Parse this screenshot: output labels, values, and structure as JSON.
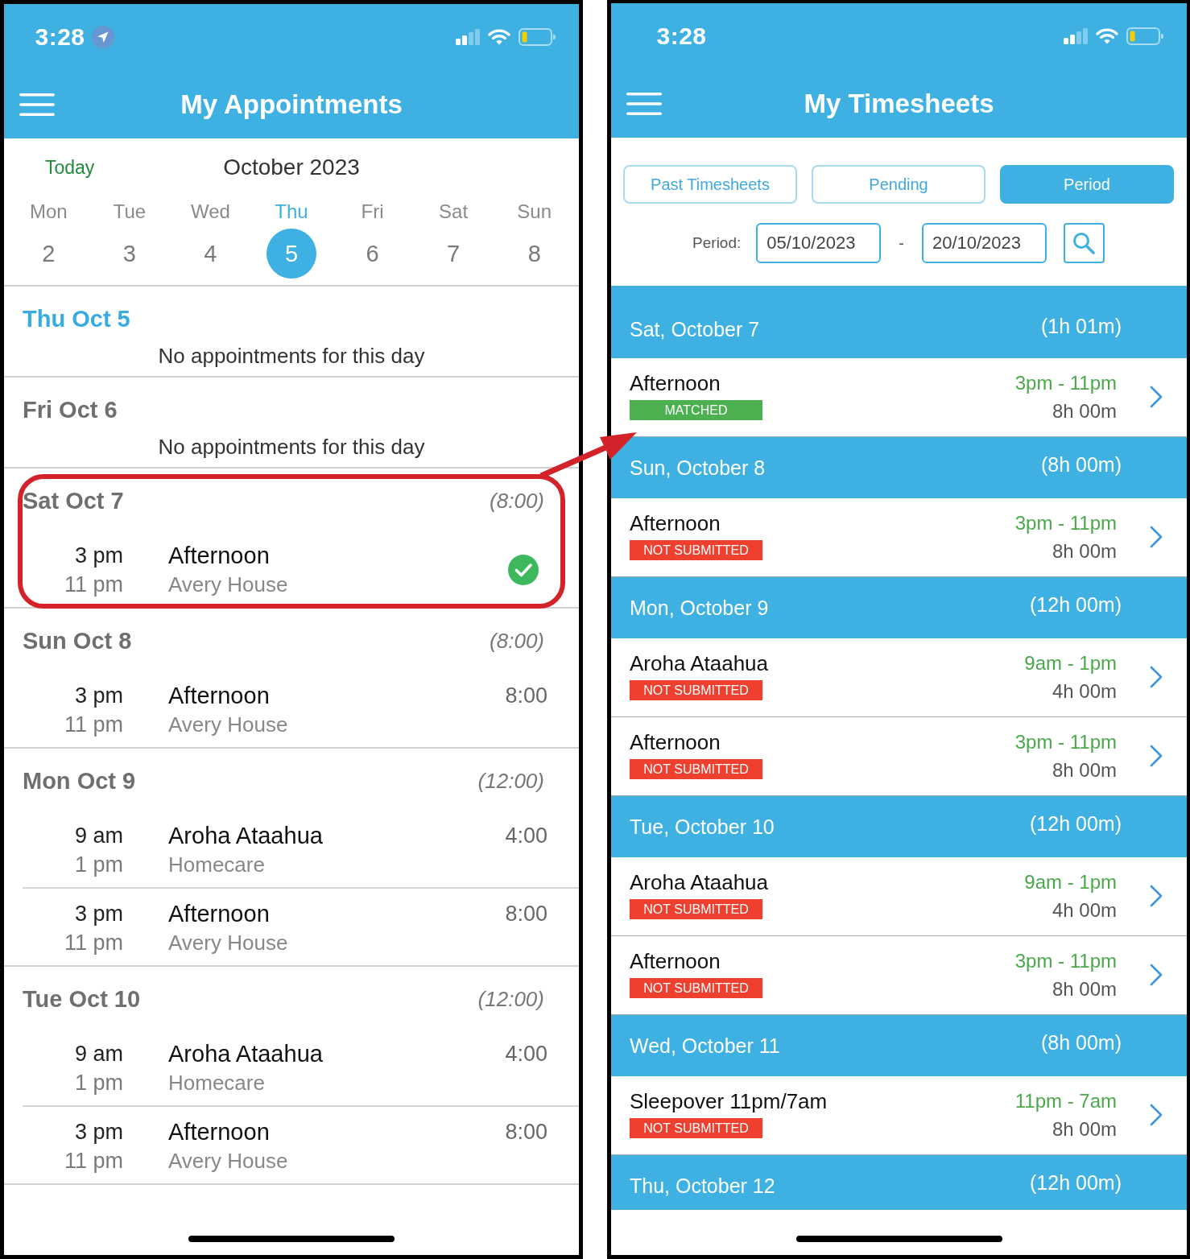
{
  "appointments_screen": {
    "status_bar": {
      "time": "3:28",
      "location_on": true
    },
    "title": "My Appointments",
    "calendar": {
      "today_button": "Today",
      "month": "October 2023",
      "days": [
        {
          "weekday": "Mon",
          "date": "2",
          "selected": false
        },
        {
          "weekday": "Tue",
          "date": "3",
          "selected": false
        },
        {
          "weekday": "Wed",
          "date": "4",
          "selected": false
        },
        {
          "weekday": "Thu",
          "date": "5",
          "selected": true
        },
        {
          "weekday": "Fri",
          "date": "6",
          "selected": false
        },
        {
          "weekday": "Sat",
          "date": "7",
          "selected": false
        },
        {
          "weekday": "Sun",
          "date": "8",
          "selected": false
        }
      ]
    },
    "days": [
      {
        "heading": "Thu Oct 5",
        "today": true,
        "highlighted": false,
        "message": "No appointments for this day"
      },
      {
        "heading": "Fri Oct 6",
        "today": false,
        "highlighted": false,
        "message": "No appointments for this day"
      },
      {
        "heading": "Sat Oct 7",
        "total": "(8:00)",
        "today": false,
        "highlighted": true,
        "appointments": [
          {
            "start": "3 pm",
            "end": "11 pm",
            "title": "Afternoon",
            "location": "Avery House",
            "confirmed": true
          }
        ]
      },
      {
        "heading": "Sun Oct 8",
        "total": "(8:00)",
        "today": false,
        "highlighted": false,
        "appointments": [
          {
            "start": "3 pm",
            "end": "11 pm",
            "title": "Afternoon",
            "location": "Avery House",
            "duration": "8:00",
            "confirmed": false
          }
        ]
      },
      {
        "heading": "Mon Oct 9",
        "total": "(12:00)",
        "today": false,
        "highlighted": false,
        "appointments": [
          {
            "start": "9 am",
            "end": "1 pm",
            "title": "Aroha Ataahua",
            "location": "Homecare",
            "duration": "4:00",
            "confirmed": false
          },
          {
            "start": "3 pm",
            "end": "11 pm",
            "title": "Afternoon",
            "location": "Avery House",
            "duration": "8:00",
            "confirmed": false
          }
        ]
      },
      {
        "heading": "Tue Oct 10",
        "total": "(12:00)",
        "today": false,
        "highlighted": false,
        "appointments": [
          {
            "start": "9 am",
            "end": "1 pm",
            "title": "Aroha Ataahua",
            "location": "Homecare",
            "duration": "4:00",
            "confirmed": false
          },
          {
            "start": "3 pm",
            "end": "11 pm",
            "title": "Afternoon",
            "location": "Avery House",
            "duration": "8:00",
            "confirmed": false
          }
        ]
      }
    ]
  },
  "timesheets_screen": {
    "status_bar": {
      "time": "3:28",
      "location_on": false
    },
    "title": "My Timesheets",
    "filters": [
      {
        "label": "Past Timesheets",
        "selected": false
      },
      {
        "label": "Pending",
        "selected": false
      },
      {
        "label": "Period",
        "selected": true
      }
    ],
    "period": {
      "label": "Period:",
      "from": "05/10/2023",
      "separator": "-",
      "to": "20/10/2023"
    },
    "groups": [
      {
        "date": "Sat, October 7",
        "total": "(1h 01m)",
        "entries": [
          {
            "title": "Afternoon",
            "status": {
              "label": "MATCHED",
              "color": "#4caf50"
            },
            "time_range": "3pm - 11pm",
            "duration": "8h 00m"
          }
        ]
      },
      {
        "date": "Sun, October 8",
        "total": "(8h 00m)",
        "entries": [
          {
            "title": "Afternoon",
            "status": {
              "label": "NOT SUBMITTED",
              "color": "#ef3f2f"
            },
            "time_range": "3pm - 11pm",
            "duration": "8h 00m"
          }
        ]
      },
      {
        "date": "Mon, October 9",
        "total": "(12h 00m)",
        "entries": [
          {
            "title": "Aroha Ataahua",
            "status": {
              "label": "NOT SUBMITTED",
              "color": "#ef3f2f"
            },
            "time_range": "9am - 1pm",
            "duration": "4h 00m"
          },
          {
            "title": "Afternoon",
            "status": {
              "label": "NOT SUBMITTED",
              "color": "#ef3f2f"
            },
            "time_range": "3pm - 11pm",
            "duration": "8h 00m"
          }
        ]
      },
      {
        "date": "Tue, October 10",
        "total": "(12h 00m)",
        "entries": [
          {
            "title": "Aroha Ataahua",
            "status": {
              "label": "NOT SUBMITTED",
              "color": "#ef3f2f"
            },
            "time_range": "9am - 1pm",
            "duration": "4h 00m"
          },
          {
            "title": "Afternoon",
            "status": {
              "label": "NOT SUBMITTED",
              "color": "#ef3f2f"
            },
            "time_range": "3pm - 11pm",
            "duration": "8h 00m"
          }
        ]
      },
      {
        "date": "Wed, October 11",
        "total": "(8h 00m)",
        "entries": [
          {
            "title": "Sleepover 11pm/7am",
            "status": {
              "label": "NOT SUBMITTED",
              "color": "#ef3f2f"
            },
            "time_range": "11pm - 7am",
            "duration": "8h 00m"
          }
        ]
      },
      {
        "date": "Thu, October 12",
        "total": "(12h 00m)"
      }
    ]
  }
}
